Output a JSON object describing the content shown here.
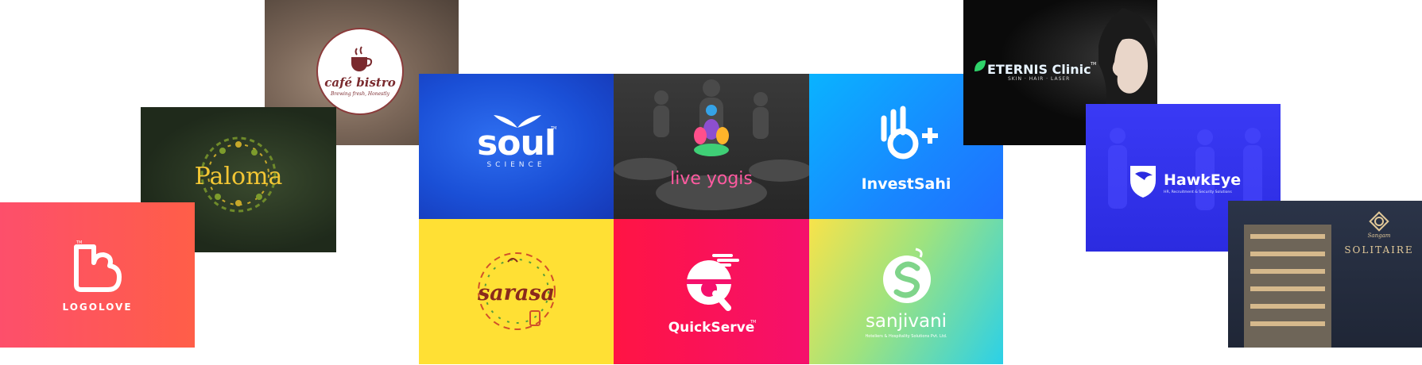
{
  "tiles": {
    "cafe_bistro": {
      "name": "café bistro",
      "tagline": "Brewing fresh, Honestly"
    },
    "paloma": {
      "name": "Paloma"
    },
    "logolove": {
      "name": "LOGOLOVE",
      "tm": "TM"
    },
    "soul": {
      "name": "soul",
      "tm": "TM",
      "sub": "SCIENCE"
    },
    "live_yogis": {
      "name": "live yogis"
    },
    "investsahi": {
      "name": "InvestSahi"
    },
    "sarasa": {
      "name": "sarasa"
    },
    "quickserve": {
      "name": "QuickServe",
      "tm": "TM"
    },
    "sanjivani": {
      "name": "sanjivani",
      "sub": "Hoteliers & Hospitality Solutions Pvt. Ltd."
    },
    "eternis": {
      "name": "ETERNIS Clinic",
      "tm": "TM",
      "sub": "SKIN · HAIR · LASER"
    },
    "hawkeye": {
      "name": "HawkEye",
      "sub": "HR, Recruitment & Security Solutions"
    },
    "solitaire": {
      "brand": "Sangam",
      "name": "SOLITAIRE"
    }
  },
  "colors": {
    "logolove_bg": "#ff5858",
    "soul_bg": "#1a4fd6",
    "investsahi_bg": "#1887ff",
    "sarasa_bg": "#ffe034",
    "quickserve_bg": "#f8104f",
    "hawkeye_bg": "#2f2fe8"
  }
}
